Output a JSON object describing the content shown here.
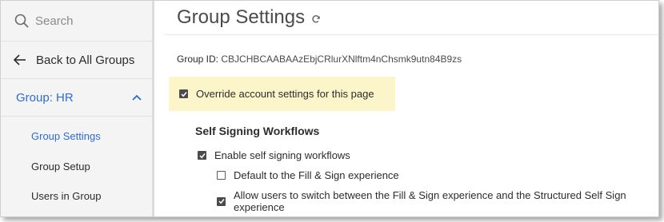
{
  "sidebar": {
    "search_placeholder": "Search",
    "back_label": "Back to All Groups",
    "group_label": "Group: HR",
    "sub_items": [
      {
        "label": "Group Settings",
        "active": true
      },
      {
        "label": "Group Setup",
        "active": false
      },
      {
        "label": "Users in Group",
        "active": false
      }
    ]
  },
  "main": {
    "title": "Group Settings",
    "group_id_label": "Group ID:",
    "group_id_value": "CBJCHBCAABAAzEbjCRlurXNlftm4nChsmk9utn84B9zs",
    "override": {
      "label": "Override account settings for this page",
      "checked": true
    },
    "section_heading": "Self Signing Workflows",
    "options": [
      {
        "label": "Enable self signing workflows",
        "checked": true
      },
      {
        "label": "Default to the Fill & Sign experience",
        "checked": false
      },
      {
        "label": "Allow users to switch between the Fill & Sign experience and the Structured Self Sign experience",
        "checked": true
      }
    ]
  },
  "colors": {
    "accent": "#2d6bd4",
    "highlight": "#fbf5c9",
    "sidebar_bg": "#f4f4f4"
  },
  "icons": [
    "search-icon",
    "arrow-left-icon",
    "chevron-up-icon",
    "refresh-icon",
    "checkmark-icon"
  ]
}
